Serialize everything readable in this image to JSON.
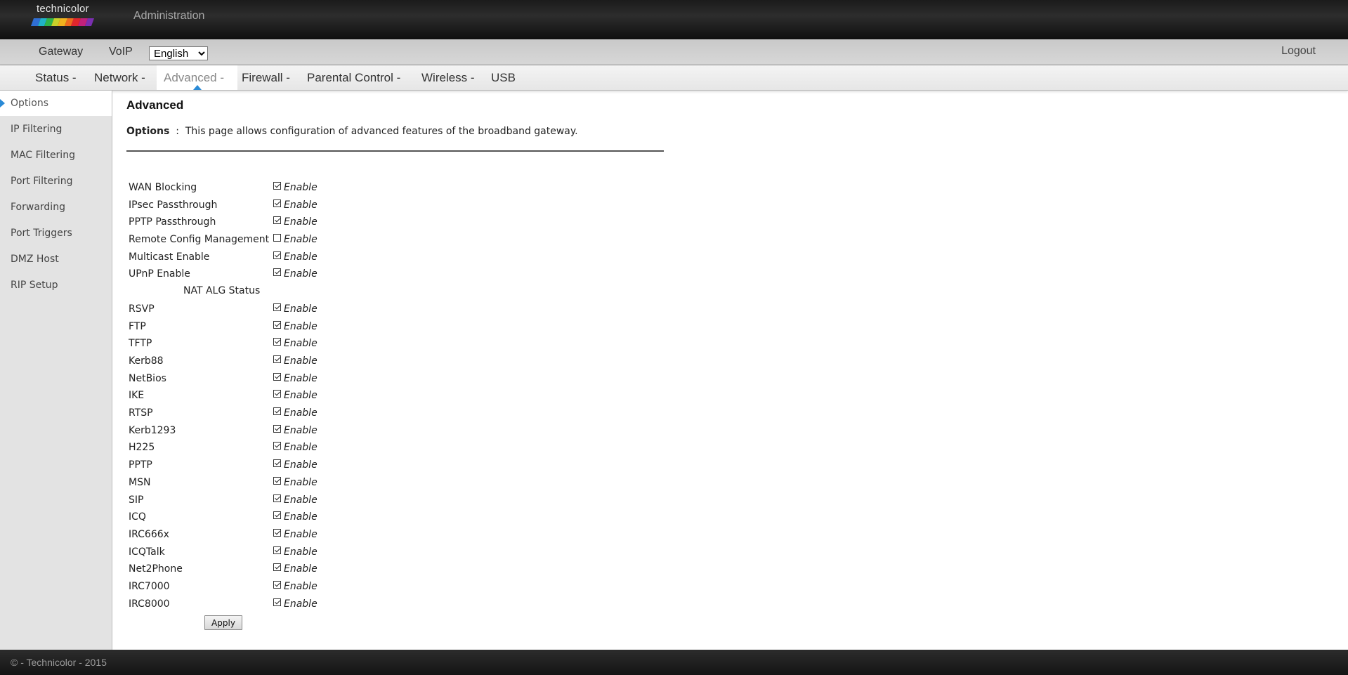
{
  "header": {
    "logo_text": "technicolor",
    "title": "Administration"
  },
  "subbar": {
    "links": [
      "Gateway",
      "VoIP"
    ],
    "language": "English",
    "logout": "Logout"
  },
  "nav": {
    "items": [
      "Status -",
      "Network -",
      "Advanced -",
      "Firewall -",
      "Parental Control -",
      "Wireless -",
      "USB"
    ],
    "active_index": 2
  },
  "sidebar": {
    "items": [
      "Options",
      "IP Filtering",
      "MAC Filtering",
      "Port Filtering",
      "Forwarding",
      "Port Triggers",
      "DMZ Host",
      "RIP Setup"
    ],
    "active_index": 0
  },
  "page": {
    "title": "Advanced",
    "desc_label": "Options",
    "desc_sep": ":",
    "desc_text": "This page allows configuration of advanced features of the broadband gateway.",
    "enable_label": "Enable",
    "options": [
      {
        "label": "WAN Blocking",
        "checked": true
      },
      {
        "label": "IPsec Passthrough",
        "checked": true
      },
      {
        "label": "PPTP Passthrough",
        "checked": true
      },
      {
        "label": "Remote Config Management",
        "checked": false
      },
      {
        "label": "Multicast Enable",
        "checked": true
      },
      {
        "label": "UPnP Enable",
        "checked": true
      }
    ],
    "nat_heading": "NAT ALG Status",
    "nat_options": [
      {
        "label": "RSVP",
        "checked": true
      },
      {
        "label": "FTP",
        "checked": true
      },
      {
        "label": "TFTP",
        "checked": true
      },
      {
        "label": "Kerb88",
        "checked": true
      },
      {
        "label": "NetBios",
        "checked": true
      },
      {
        "label": "IKE",
        "checked": true
      },
      {
        "label": "RTSP",
        "checked": true
      },
      {
        "label": "Kerb1293",
        "checked": true
      },
      {
        "label": "H225",
        "checked": true
      },
      {
        "label": "PPTP",
        "checked": true
      },
      {
        "label": "MSN",
        "checked": true
      },
      {
        "label": "SIP",
        "checked": true
      },
      {
        "label": "ICQ",
        "checked": true
      },
      {
        "label": "IRC666x",
        "checked": true
      },
      {
        "label": "ICQTalk",
        "checked": true
      },
      {
        "label": "Net2Phone",
        "checked": true
      },
      {
        "label": "IRC7000",
        "checked": true
      },
      {
        "label": "IRC8000",
        "checked": true
      }
    ],
    "apply_label": "Apply"
  },
  "footer": {
    "text": "© - Technicolor - 2015"
  },
  "colors": {
    "accent": "#2a8ad6",
    "header_bg": "#1b1b1b",
    "sidebar_bg": "#e3e3e3"
  }
}
